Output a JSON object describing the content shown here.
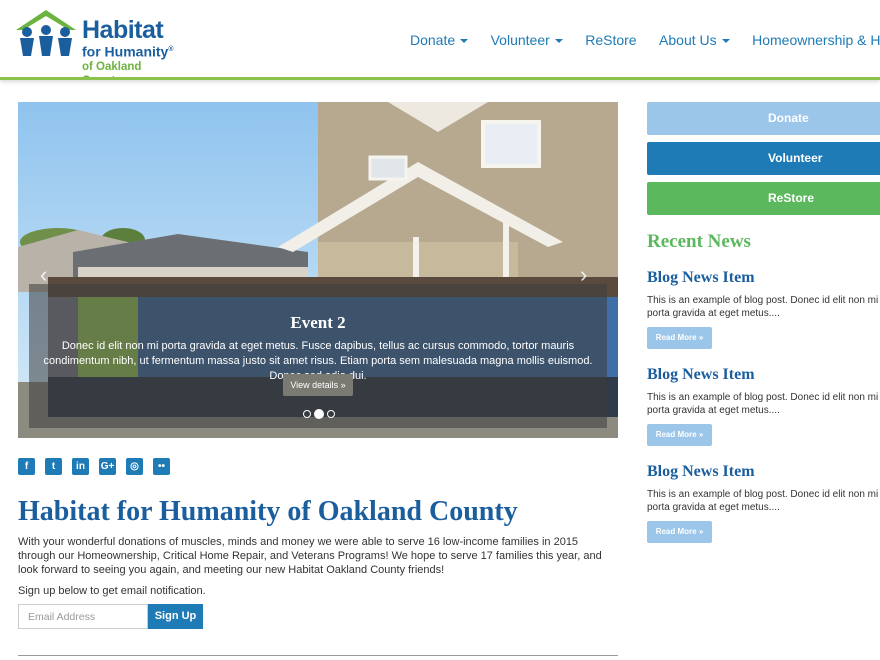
{
  "logo": {
    "line1": "Habitat",
    "line2": "for Humanity",
    "line3": "of Oakland County",
    "registered": "®"
  },
  "nav": {
    "items": [
      {
        "label": "Donate",
        "dropdown": true
      },
      {
        "label": "Volunteer",
        "dropdown": true
      },
      {
        "label": "ReStore",
        "dropdown": false
      },
      {
        "label": "About Us",
        "dropdown": true
      },
      {
        "label": "Homeownership & Home Repair",
        "dropdown": false
      }
    ]
  },
  "carousel": {
    "title": "Event 2",
    "text": "Donec id elit non mi porta gravida at eget metus. Fusce dapibus, tellus ac cursus commodo, tortor mauris condimentum nibh, ut fermentum massa justo sit amet risus. Etiam porta sem malesuada magna mollis euismod. Donec sed odio dui.",
    "button": "View details »",
    "prev": "‹",
    "next": "›",
    "slide_count": 3,
    "active_index": 1
  },
  "social": {
    "icons": [
      {
        "name": "facebook-icon",
        "glyph": "f"
      },
      {
        "name": "twitter-icon",
        "glyph": "t"
      },
      {
        "name": "linkedin-icon",
        "glyph": "in"
      },
      {
        "name": "google-plus-icon",
        "glyph": "G+"
      },
      {
        "name": "instagram-icon",
        "glyph": "◎"
      },
      {
        "name": "flickr-icon",
        "glyph": "••"
      }
    ]
  },
  "main": {
    "title": "Habitat for Humanity of Oakland County",
    "intro": "With your wonderful donations of muscles, minds and money we were able to serve 16 low-income families in 2015 through our Homeownership, Critical Home Repair, and Veterans Programs! We hope to serve 17 families this year, and look forward to seeing you again, and meeting our new Habitat Oakland County friends!",
    "signup_label": "Sign up below to get email notification.",
    "email_placeholder": "Email Address",
    "signup_button": "Sign Up"
  },
  "sidebar": {
    "buttons": [
      "Donate",
      "Volunteer",
      "ReStore"
    ],
    "recent_title": "Recent News",
    "news": [
      {
        "title": "Blog News Item",
        "excerpt": "This is an example of blog post. Donec id elit non mi porta gravida at eget metus....",
        "read_more": "Read More »"
      },
      {
        "title": "Blog News Item",
        "excerpt": "This is an example of blog post. Donec id elit non mi porta gravida at eget metus....",
        "read_more": "Read More »"
      },
      {
        "title": "Blog News Item",
        "excerpt": "This is an example of blog post. Donec id elit non mi porta gravida at eget metus....",
        "read_more": "Read More »"
      }
    ]
  },
  "colors": {
    "brand_blue": "#1b5e9e",
    "link_blue": "#1e7bb6",
    "brand_green": "#5cb85c",
    "light_blue": "#9bc6ea"
  }
}
